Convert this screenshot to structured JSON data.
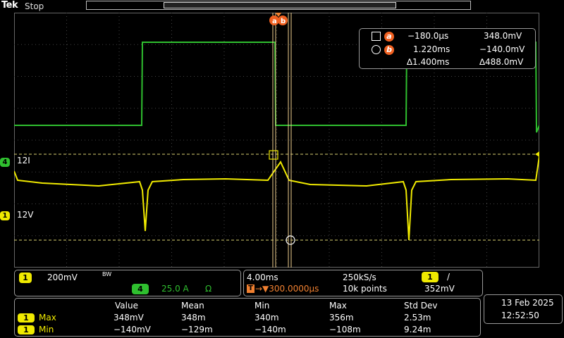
{
  "header": {
    "brand": "Tek",
    "status": "Stop"
  },
  "channels": {
    "ch4_marker": "4",
    "ch4_label": "12I",
    "ch1_marker": "1",
    "ch1_label": "12V"
  },
  "cursors": {
    "a_label": "a",
    "b_label": "b",
    "a_time": "−180.0µs",
    "a_value": "348.0mV",
    "b_time": "1.220ms",
    "b_value": "−140.0mV",
    "delta_time": "∆1.400ms",
    "delta_value": "∆488.0mV"
  },
  "vertical": {
    "ch1_badge": "1",
    "ch1_scale": "200mV",
    "bw_label": "BW",
    "ch4_badge": "4",
    "ch4_scale": "25.0 A",
    "ohm_symbol": "Ω"
  },
  "horizontal": {
    "timebase": "4.00ms",
    "sample_rate": "250kS/s",
    "trigger_channel": "1",
    "trigger_slope": "/",
    "trigger_position": "→▼300.0000µs",
    "record_length": "10k points",
    "trigger_level": "352mV"
  },
  "measurements": {
    "headers": [
      "Value",
      "Mean",
      "Min",
      "Max",
      "Std Dev"
    ],
    "rows": [
      {
        "channel": "1",
        "name": "Max",
        "values": [
          "348mV",
          "348m",
          "340m",
          "356m",
          "2.53m"
        ]
      },
      {
        "channel": "1",
        "name": "Min",
        "values": [
          "−140mV",
          "−129m",
          "−140m",
          "−108m",
          "9.24m"
        ]
      }
    ]
  },
  "datetime": {
    "date": "13 Feb  2025",
    "time": "12:52:50"
  },
  "colors": {
    "ch1": "#f0ea00",
    "ch4": "#2fbf2f",
    "cursor": "#f08030",
    "grid": "#555555"
  }
}
